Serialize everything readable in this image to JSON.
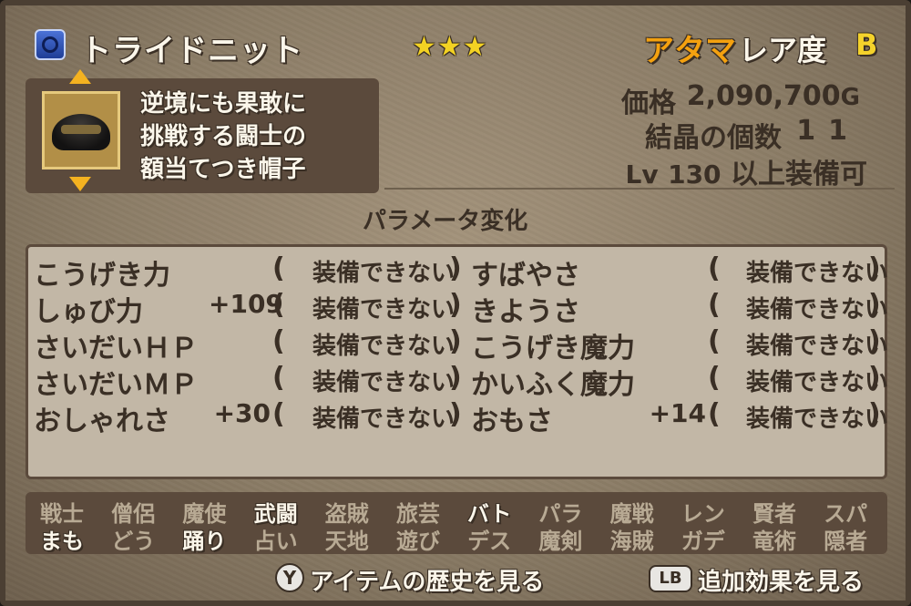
{
  "header": {
    "item_name": "トライドニット",
    "stars": "★★★",
    "slot": "アタマ",
    "rarity_label": "レア度",
    "rarity_grade": "B"
  },
  "description": {
    "lines": [
      "逆境にも果敢に",
      "挑戦する闘士の",
      "額当てつき帽子"
    ]
  },
  "info": {
    "price_label": "価格",
    "price_value": "2,090,700",
    "price_unit": "G",
    "crystal_label": "結晶の個数",
    "crystal_value": "11",
    "level_prefix": "Lv",
    "level_value": "130",
    "level_suffix": "以上装備可"
  },
  "params": {
    "title": "パラメータ変化",
    "left": [
      {
        "name": "こうげき力",
        "delta": "",
        "status": "装備できない"
      },
      {
        "name": "しゅび力",
        "delta": "+109",
        "status": "装備できない"
      },
      {
        "name": "さいだいＨＰ",
        "delta": "",
        "status": "装備できない"
      },
      {
        "name": "さいだいＭＰ",
        "delta": "",
        "status": "装備できない"
      },
      {
        "name": "おしゃれさ",
        "delta": "+30",
        "status": "装備できない"
      }
    ],
    "right": [
      {
        "name": "すばやさ",
        "delta": "",
        "status": "装備できない"
      },
      {
        "name": "きようさ",
        "delta": "",
        "status": "装備できない"
      },
      {
        "name": "こうげき魔力",
        "delta": "",
        "status": "装備できない"
      },
      {
        "name": "かいふく魔力",
        "delta": "",
        "status": "装備できない"
      },
      {
        "name": "おもさ",
        "delta": "+14",
        "status": "装備できない"
      }
    ]
  },
  "jobs": {
    "row1": [
      {
        "label": "戦士",
        "usable": false
      },
      {
        "label": "僧侶",
        "usable": false
      },
      {
        "label": "魔使",
        "usable": false
      },
      {
        "label": "武闘",
        "usable": true
      },
      {
        "label": "盗賊",
        "usable": false
      },
      {
        "label": "旅芸",
        "usable": false
      },
      {
        "label": "バト",
        "usable": true
      },
      {
        "label": "パラ",
        "usable": false
      },
      {
        "label": "魔戦",
        "usable": false
      },
      {
        "label": "レン",
        "usable": false
      },
      {
        "label": "賢者",
        "usable": false
      },
      {
        "label": "スパ",
        "usable": false
      }
    ],
    "row2": [
      {
        "label": "まも",
        "usable": true
      },
      {
        "label": "どう",
        "usable": false
      },
      {
        "label": "踊り",
        "usable": true
      },
      {
        "label": "占い",
        "usable": false
      },
      {
        "label": "天地",
        "usable": false
      },
      {
        "label": "遊び",
        "usable": false
      },
      {
        "label": "デス",
        "usable": false
      },
      {
        "label": "魔剣",
        "usable": false
      },
      {
        "label": "海賊",
        "usable": false
      },
      {
        "label": "ガデ",
        "usable": false
      },
      {
        "label": "竜術",
        "usable": false
      },
      {
        "label": "隠者",
        "usable": false
      }
    ]
  },
  "footer": {
    "y_button": "Y",
    "y_hint": "アイテムの歴史を見る",
    "lb_button": "LB",
    "lb_hint": "追加効果を見る"
  },
  "colors": {
    "slot": "#f4a10f",
    "stars": "#f3d223",
    "rarity_grade": "#f4d22b",
    "arrow": "#f4b220"
  }
}
